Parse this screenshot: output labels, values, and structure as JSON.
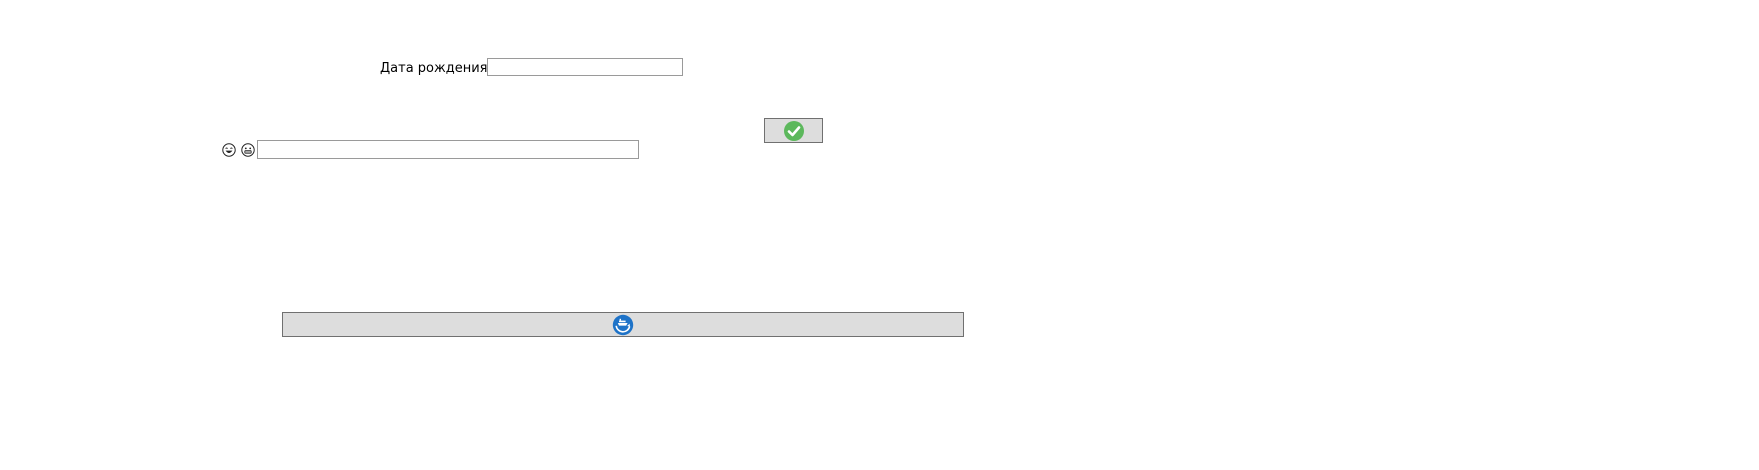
{
  "form": {
    "dob_label": "Дата рождения",
    "dob_value": "",
    "dob_placeholder": "",
    "text_value": "",
    "text_placeholder": ""
  },
  "icons": {
    "ok_button_icon": "check-circle-icon",
    "emoji_1": "laughing-face-icon",
    "emoji_2": "grinning-face-icon",
    "wide_button_icon": "ship-refresh-icon"
  },
  "colors": {
    "button_bg": "#dddddd",
    "check_green": "#5cb85c",
    "ship_blue": "#1e73c8"
  }
}
